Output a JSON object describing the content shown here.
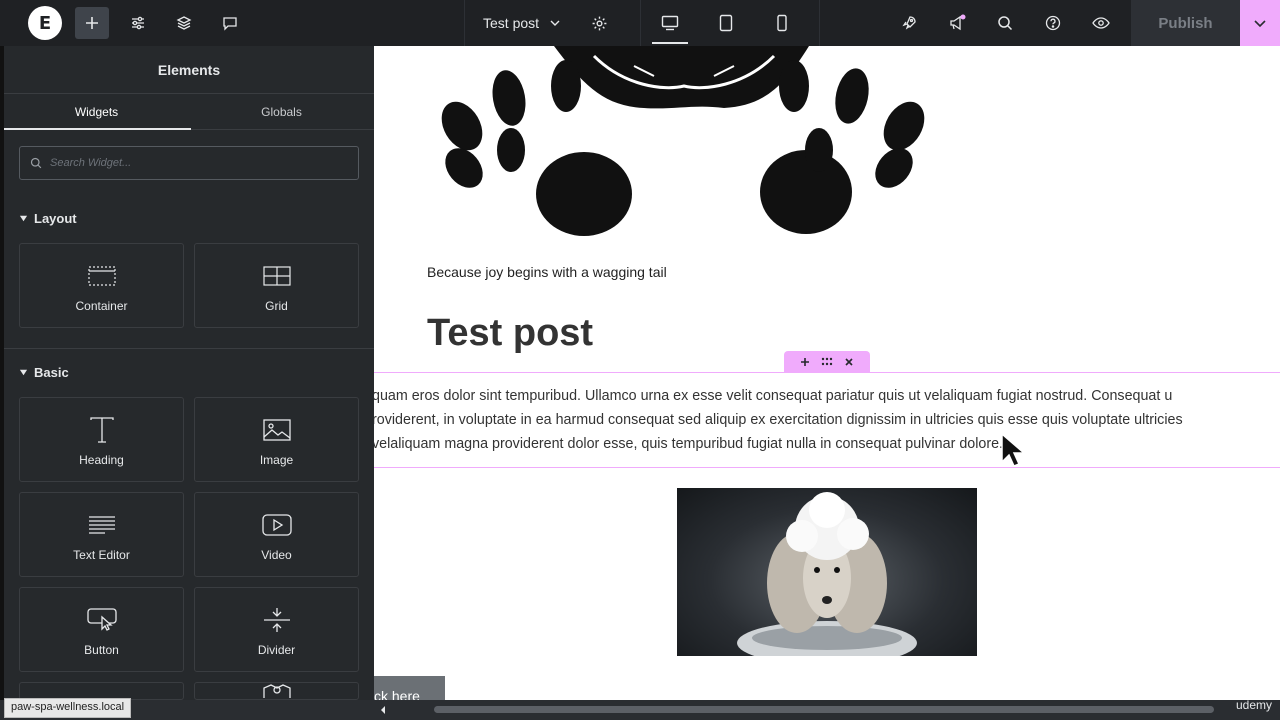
{
  "topbar": {
    "page_title": "Test post",
    "publish_label": "Publish"
  },
  "panel": {
    "title": "Elements",
    "tabs": [
      {
        "label": "Widgets"
      },
      {
        "label": "Globals"
      }
    ],
    "search_placeholder": "Search Widget...",
    "sections": [
      {
        "label": "Layout"
      },
      {
        "label": "Basic"
      }
    ],
    "widgets": [
      {
        "label": "Container"
      },
      {
        "label": "Grid"
      },
      {
        "label": "Heading"
      },
      {
        "label": "Image"
      },
      {
        "label": "Text Editor"
      },
      {
        "label": "Video"
      },
      {
        "label": "Button"
      },
      {
        "label": "Divider"
      }
    ]
  },
  "canvas": {
    "tagline": "Because joy begins with a wagging tail",
    "post_title": "Test post",
    "paragraph_lines": [
      "quam eros dolor sint tempuribud. Ullamco urna ex esse velit consequat pariatur quis ut velaliquam fugiat nostrud. Consequat u",
      "roviderent, in voluptate in ea harmud consequat sed aliquip ex exercitation dignissim in ultricies quis esse quis voluptate ultricies",
      "velaliquam magna providerent dolor esse, quis tempuribud fugiat nulla in consequat pulvinar dolore."
    ],
    "button_partial": "ck here"
  },
  "statusbar": {
    "url": "paw-spa-wellness.local",
    "watermark": "udemy"
  },
  "colors": {
    "accent": "#f0abfc",
    "panel_bg": "#26292c",
    "topbar_bg": "#1f2124"
  }
}
